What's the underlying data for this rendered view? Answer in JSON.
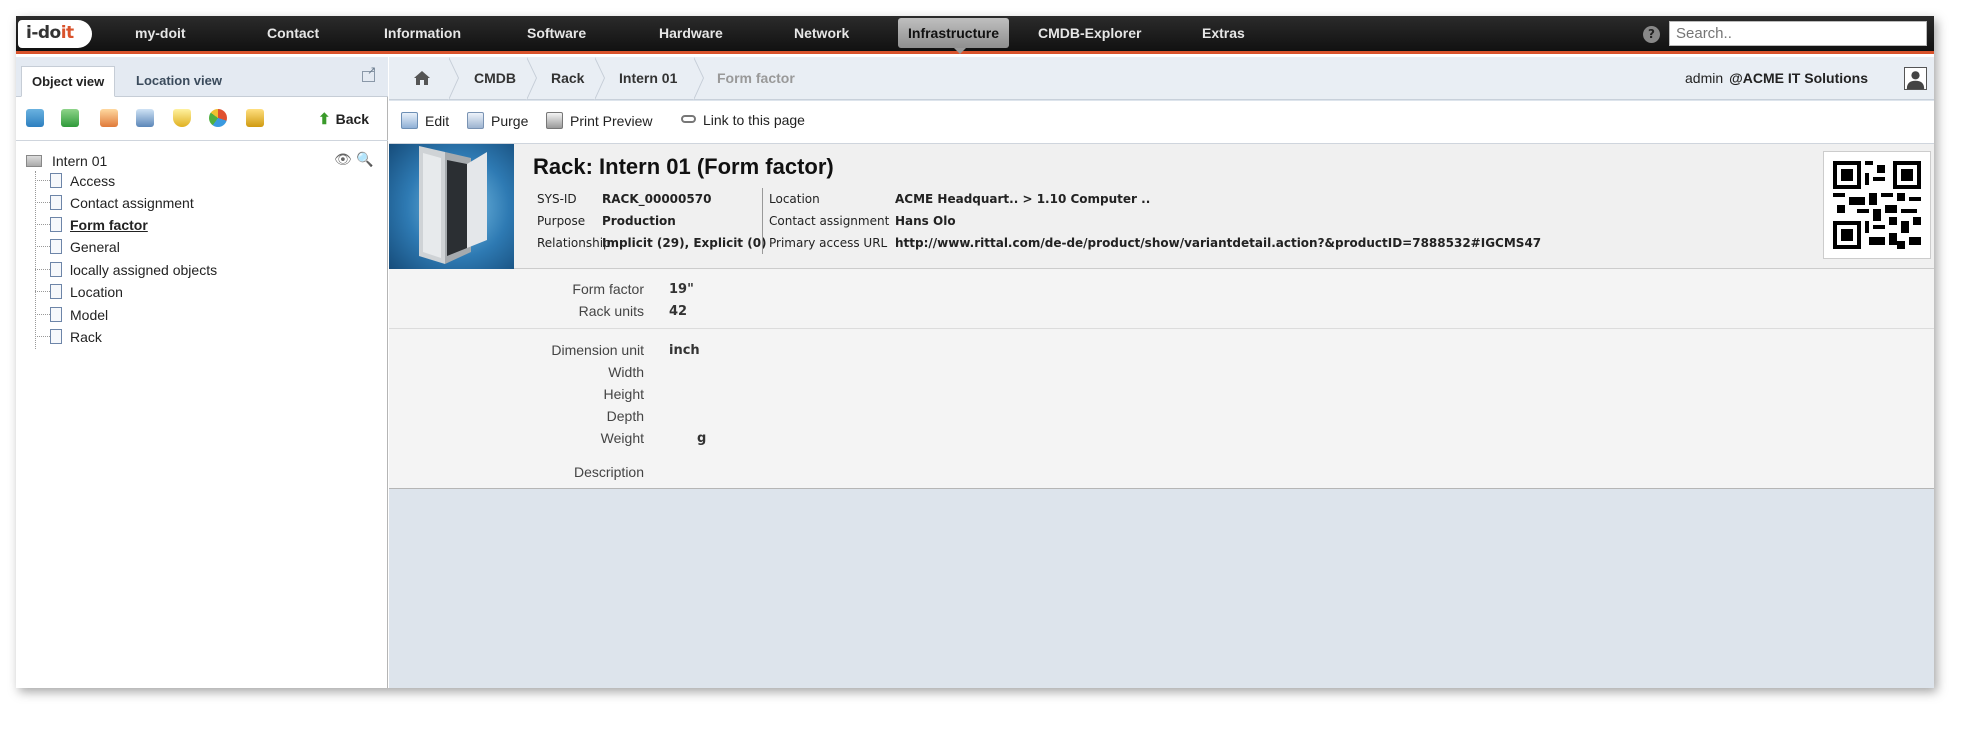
{
  "logo": {
    "text_a": "i-do",
    "text_b": "it"
  },
  "topnav": {
    "items": [
      "my-doit",
      "Contact",
      "Information",
      "Software",
      "Hardware",
      "Network",
      "Infrastructure",
      "CMDB-Explorer",
      "Extras"
    ],
    "active": "Infrastructure",
    "search_placeholder": "Search.."
  },
  "left_panel": {
    "tabs": [
      "Object view",
      "Location view"
    ],
    "active_tab": "Object view",
    "back_label": "Back",
    "tree": {
      "root": "Intern 01",
      "items": [
        "Access",
        "Contact assignment",
        "Form factor",
        "General",
        "locally assigned objects",
        "Location",
        "Model",
        "Rack"
      ],
      "selected": "Form factor"
    }
  },
  "breadcrumb": [
    "CMDB",
    "Rack",
    "Intern 01",
    "Form factor"
  ],
  "user": {
    "name": "admin",
    "org": "@ACME IT Solutions"
  },
  "actions": [
    "Edit",
    "Purge",
    "Print Preview",
    "Link to this page"
  ],
  "header": {
    "title": "Rack: Intern 01 (Form factor)",
    "sys_id_label": "SYS-ID",
    "sys_id": "RACK_00000570",
    "purpose_label": "Purpose",
    "purpose": "Production",
    "relationship_label": "Relationship",
    "relationship": "Implicit (29), Explicit (0)",
    "location_label": "Location",
    "location": "ACME Headquart.. > 1.10 Computer ..",
    "contact_label": "Contact assignment",
    "contact": "Hans Olo",
    "url_label": "Primary access URL",
    "url": "http://www.rittal.com/de-de/product/show/variantdetail.action?&productID=7888532#IGCMS47"
  },
  "form": {
    "form_factor_label": "Form factor",
    "form_factor": "19\"",
    "rack_units_label": "Rack units",
    "rack_units": "42",
    "dimension_unit_label": "Dimension unit",
    "dimension_unit": "inch",
    "width_label": "Width",
    "height_label": "Height",
    "depth_label": "Depth",
    "weight_label": "Weight",
    "weight_unit": "g",
    "description_label": "Description"
  },
  "colors": {
    "accent": "#d9532c",
    "nav_bg": "#1a1a1a",
    "panel_bg": "#dde4ec"
  }
}
